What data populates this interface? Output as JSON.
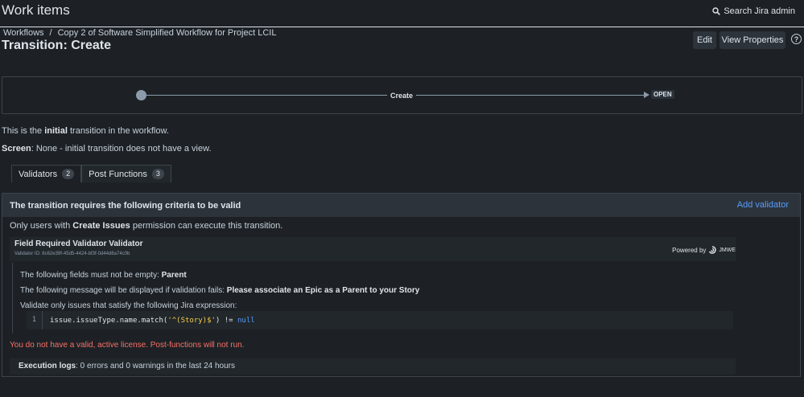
{
  "header": {
    "app_title": "Work items",
    "search_label": "Search Jira admin"
  },
  "breadcrumb": {
    "root": "Workflows",
    "separator": "/",
    "current": "Copy 2 of Software Simplified Workflow for Project LCIL"
  },
  "page": {
    "title": "Transition: Create"
  },
  "actions": {
    "edit_label": "Edit",
    "view_properties_label": "View Properties",
    "help_glyph": "?"
  },
  "diagram": {
    "transition_label": "Create",
    "target_status": "OPEN"
  },
  "description": {
    "line1_prefix": "This is the ",
    "line1_bold": "initial",
    "line1_suffix": " transition in the workflow.",
    "screen_label": "Screen",
    "screen_value": ": None - initial transition does not have a view."
  },
  "tabs": [
    {
      "label": "Validators",
      "count": "2"
    },
    {
      "label": "Post Functions",
      "count": "3"
    }
  ],
  "validators_panel": {
    "header_title": "The transition requires the following criteria to be valid",
    "add_validator_label": "Add validator",
    "permission_prefix": "Only users with ",
    "permission_bold": "Create Issues",
    "permission_suffix": " permission can execute this transition.",
    "card": {
      "title": "Field Required Validator Validator",
      "id_text": "Validator ID: 8c62e39f-45d5-4424-bf3f-0d44d8a74c0b",
      "powered_by": "Powered by",
      "brand": "JMWE",
      "fields_prefix": "The following fields must not be empty: ",
      "fields_value": "Parent",
      "message_prefix": "The following message will be displayed if validation fails: ",
      "message_value": "Please associate an Epic as a Parent to your Story",
      "expression_intro": "Validate only issues that satisfy the following Jira expression:",
      "code_line_number": "1",
      "code_part1": "issue.issueType.name.match(",
      "code_string": "'^(Story)$'",
      "code_part2": ") != ",
      "code_keyword": "null"
    },
    "license_warning": "You do not have a valid, active license. Post-functions will not run.",
    "exec_label": "Execution logs",
    "exec_value": ": 0 errors and 0 warnings in the last 24 hours"
  },
  "icons": {
    "search": "search-icon",
    "help": "help-icon",
    "brand": "jmwe-logo-icon"
  }
}
